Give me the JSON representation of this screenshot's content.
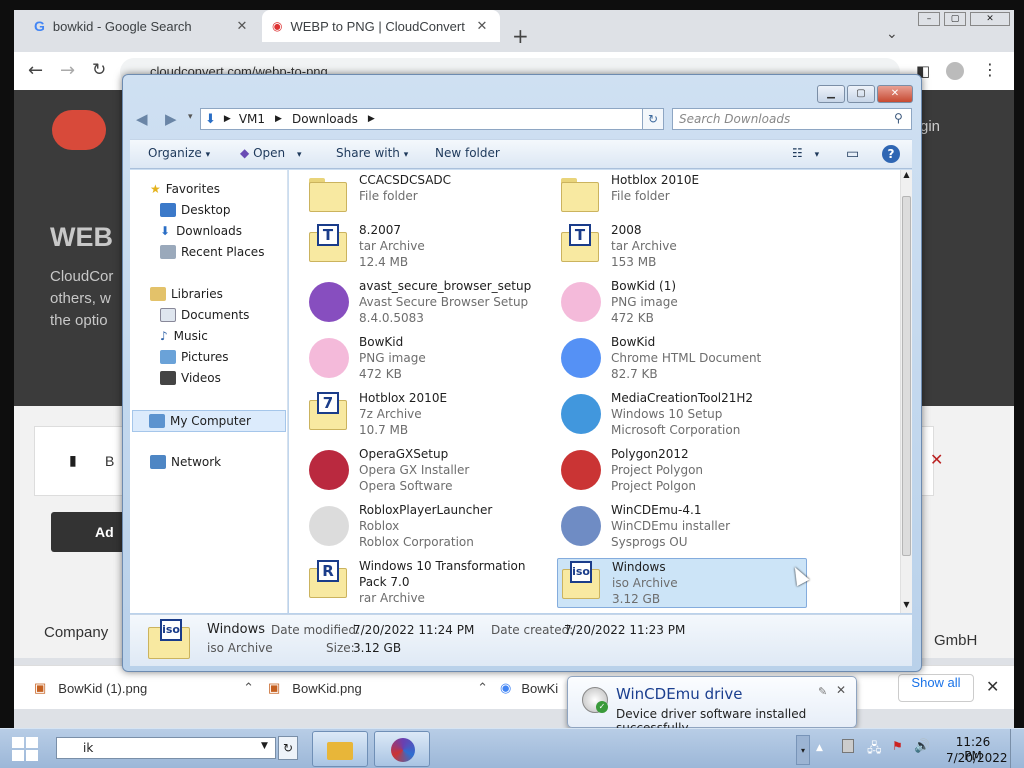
{
  "browser": {
    "tabs": [
      {
        "title": "bowkid - Google Search",
        "active": false
      },
      {
        "title": "WEBP to PNG | CloudConvert",
        "active": true
      }
    ],
    "url": "cloudconvert.com/webp-to-png"
  },
  "page": {
    "hero_heading": "WEB",
    "hero_text_lines": [
      "CloudCor",
      "others, w",
      "the optio"
    ],
    "login_fragment": "gin",
    "row_fragment": "B",
    "add_fragment": "Ad",
    "company_label": "Company",
    "gmbh_fragment": "GmbH"
  },
  "downloads_bar": {
    "items": [
      "BowKid (1).png",
      "BowKid.png",
      "BowKi"
    ],
    "show_all": "Show all"
  },
  "explorer": {
    "breadcrumb": [
      "VM1",
      "Downloads"
    ],
    "search_placeholder": "Search Downloads",
    "toolbar": {
      "organize": "Organize",
      "open": "Open",
      "share": "Share with",
      "new_folder": "New folder"
    },
    "nav": {
      "favorites": "Favorites",
      "fav_items": [
        "Desktop",
        "Downloads",
        "Recent Places"
      ],
      "libraries": "Libraries",
      "lib_items": [
        "Documents",
        "Music",
        "Pictures",
        "Videos"
      ],
      "computer": "My Computer",
      "network": "Network"
    },
    "files": [
      {
        "name": "CCACSDCSADC",
        "line2": "File folder",
        "line3": "",
        "icon": "folder"
      },
      {
        "name": "Hotblox 2010E",
        "line2": "File folder",
        "line3": "",
        "icon": "folder-open"
      },
      {
        "name": "8.2007",
        "line2": "tar Archive",
        "line3": "12.4 MB",
        "icon": "archive-T"
      },
      {
        "name": "2008",
        "line2": "tar Archive",
        "line3": "153 MB",
        "icon": "archive-T"
      },
      {
        "name": "avast_secure_browser_setup",
        "line2": "Avast Secure Browser Setup",
        "line3": "8.4.0.5083",
        "icon": "avast"
      },
      {
        "name": "BowKid (1)",
        "line2": "PNG image",
        "line3": "472 KB",
        "icon": "image"
      },
      {
        "name": "BowKid",
        "line2": "PNG image",
        "line3": "472 KB",
        "icon": "image"
      },
      {
        "name": "BowKid",
        "line2": "Chrome HTML Document",
        "line3": "82.7 KB",
        "icon": "chrome"
      },
      {
        "name": "Hotblox 2010E",
        "line2": "7z Archive",
        "line3": "10.7 MB",
        "icon": "archive-7"
      },
      {
        "name": "MediaCreationTool21H2",
        "line2": "Windows 10 Setup",
        "line3": "Microsoft Corporation",
        "icon": "setup"
      },
      {
        "name": "OperaGXSetup",
        "line2": "Opera GX Installer",
        "line3": "Opera Software",
        "icon": "opera"
      },
      {
        "name": "Polygon2012",
        "line2": "Project Polygon",
        "line3": "Project Polgon",
        "icon": "polygon"
      },
      {
        "name": "RobloxPlayerLauncher",
        "line2": "Roblox",
        "line3": "Roblox Corporation",
        "icon": "roblox"
      },
      {
        "name": "WinCDEmu-4.1",
        "line2": "WinCDEmu installer",
        "line3": "Sysprogs OU",
        "icon": "cd"
      },
      {
        "name": "Windows 10 Transformation Pack 7.0",
        "line2": "rar Archive",
        "line3": "",
        "icon": "archive-R"
      },
      {
        "name": "Windows",
        "line2": "iso Archive",
        "line3": "3.12 GB",
        "icon": "archive-iso"
      }
    ],
    "details": {
      "name": "Windows",
      "type": "iso Archive",
      "modified_label": "Date modified:",
      "modified": "7/20/2022 11:24 PM",
      "created_label": "Date created:",
      "created": "7/20/2022 11:23 PM",
      "size_label": "Size:",
      "size": "3.12 GB"
    }
  },
  "notification": {
    "title": "WinCDEmu drive",
    "message": "Device driver software installed successfully."
  },
  "taskbar": {
    "address_value": "ik",
    "time": "11:26 PM",
    "date": "7/20/2022"
  },
  "colors": {
    "accent": "#1a3c8a",
    "selection": "#cce4f7",
    "hero": "#3b3b3b"
  }
}
